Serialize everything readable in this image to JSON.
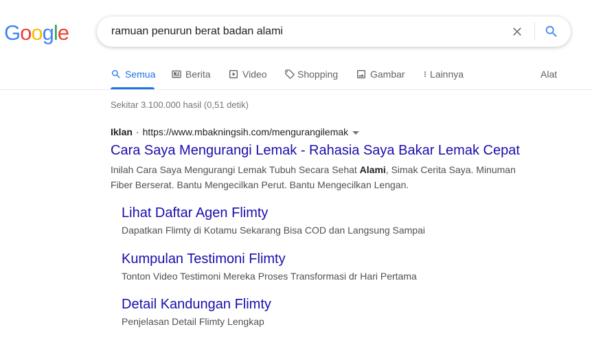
{
  "logo": {
    "letters": [
      "G",
      "o",
      "o",
      "g",
      "l",
      "e"
    ],
    "colors": [
      "#4285f4",
      "#ea4335",
      "#fbbc05",
      "#4285f4",
      "#34a853",
      "#ea4335"
    ]
  },
  "search": {
    "query": "ramuan penurun berat badan alami",
    "clear_icon": "close-icon",
    "submit_icon": "search-icon"
  },
  "tabs": [
    {
      "label": "Semua",
      "icon": "search-icon",
      "active": true
    },
    {
      "label": "Berita",
      "icon": "newspaper-icon"
    },
    {
      "label": "Video",
      "icon": "play-icon"
    },
    {
      "label": "Shopping",
      "icon": "tag-icon"
    },
    {
      "label": "Gambar",
      "icon": "image-icon"
    },
    {
      "label": "Lainnya",
      "icon": "more-vert-icon"
    }
  ],
  "tools_label": "Alat",
  "stats": "Sekitar 3.100.000 hasil (0,51 detik)",
  "ad": {
    "label": "Iklan",
    "separator": "·",
    "url": "https://www.mbakningsih.com/mengurangilemak",
    "title": "Cara Saya Mengurangi Lemak - Rahasia Saya Bakar Lemak Cepat",
    "desc_before": "Inilah Cara Saya Mengurangi Lemak Tubuh Secara Sehat ",
    "desc_bold": "Alami",
    "desc_after": ", Simak Cerita Saya. Minuman Fiber Berserat. Bantu Mengecilkan Perut. Bantu Mengecilkan Lengan."
  },
  "sitelinks": [
    {
      "title": "Lihat Daftar Agen Flimty",
      "desc": "Dapatkan Flimty di Kotamu Sekarang Bisa COD dan Langsung Sampai"
    },
    {
      "title": "Kumpulan Testimoni Flimty",
      "desc": "Tonton Video Testimoni Mereka Proses Transformasi dr Hari Pertama"
    },
    {
      "title": "Detail Kandungan Flimty",
      "desc": "Penjelasan Detail Flimty Lengkap"
    }
  ],
  "colors": {
    "link": "#1a0dab",
    "accent": "#1a73e8",
    "muted": "#70757a",
    "text": "#4d5156"
  }
}
